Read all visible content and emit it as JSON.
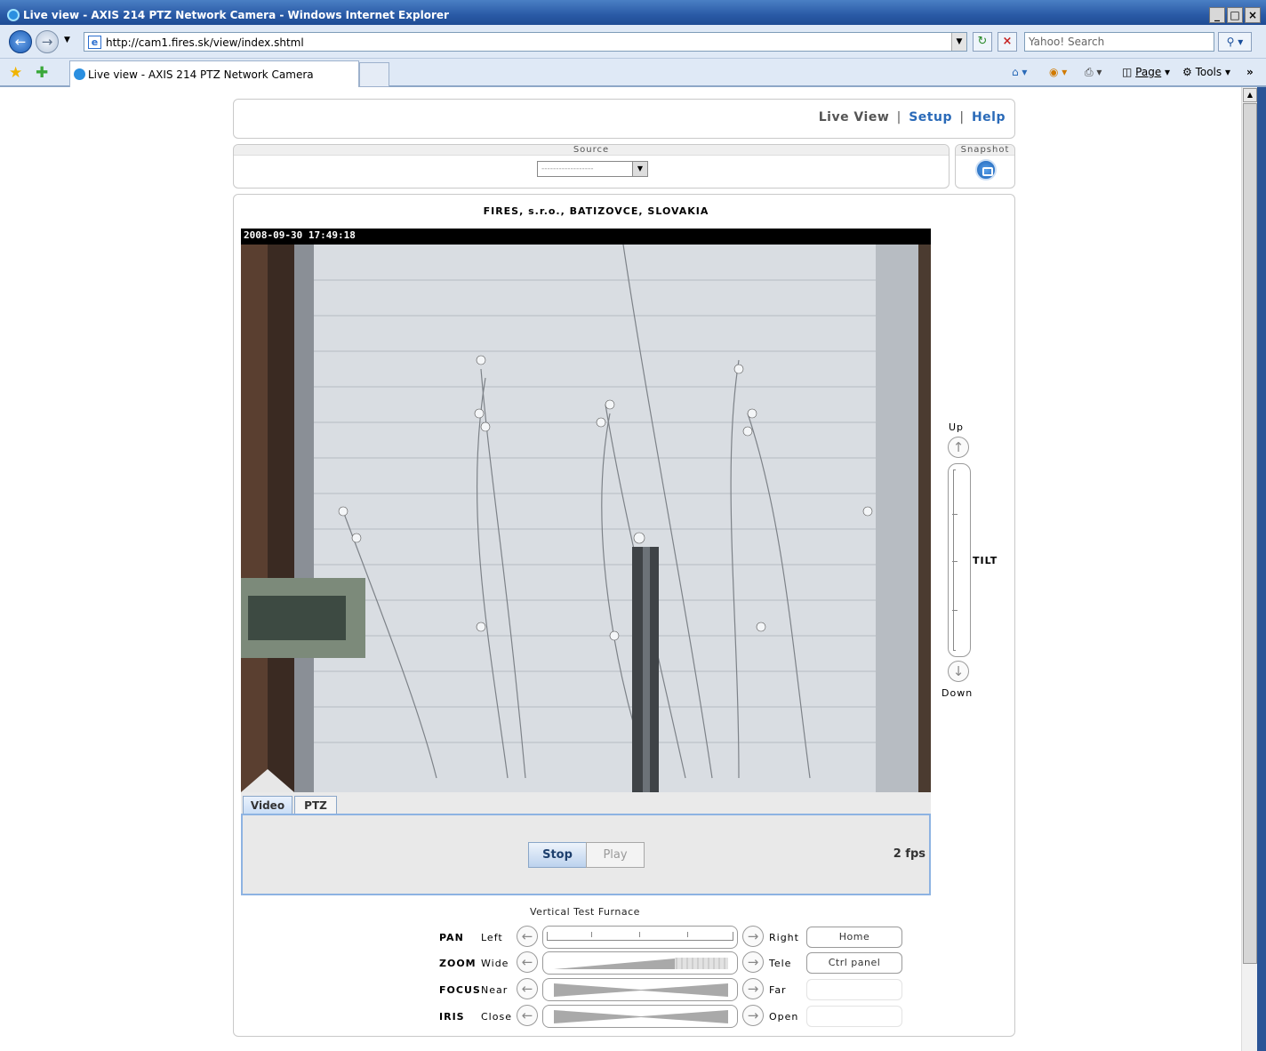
{
  "browser": {
    "window_title": "Live view - AXIS 214 PTZ Network Camera - Windows Internet Explorer",
    "url": "http://cam1.fires.sk/view/index.shtml",
    "search_placeholder": "Yahoo! Search",
    "tab_title": "Live view - AXIS 214 PTZ Network Camera",
    "page_menu": "Page",
    "tools_menu": "Tools",
    "win_min": "_",
    "win_max": "□",
    "win_close": "×",
    "chevron": "»"
  },
  "header": {
    "live_view": "Live View",
    "setup": "Setup",
    "help": "Help",
    "sep": "|"
  },
  "source": {
    "label": "Source",
    "value": "------------------"
  },
  "snapshot": {
    "label": "Snapshot"
  },
  "camera": {
    "title": "FIRES, s.r.o., BATIZOVCE, SLOVAKIA",
    "timestamp": "2008-09-30 17:49:18"
  },
  "tabs": {
    "video": "Video",
    "ptz": "PTZ"
  },
  "video_controls": {
    "stop": "Stop",
    "play": "Play",
    "fps": "2 fps"
  },
  "tilt": {
    "up": "Up",
    "down": "Down",
    "label": "TILT"
  },
  "ptz": {
    "preset_title": "Vertical Test Furnace",
    "rows": [
      {
        "name": "PAN",
        "left": "Left",
        "right": "Right",
        "button": "Home"
      },
      {
        "name": "ZOOM",
        "left": "Wide",
        "right": "Tele",
        "button": "Ctrl panel"
      },
      {
        "name": "FOCUS",
        "left": "Near",
        "right": "Far",
        "button": ""
      },
      {
        "name": "IRIS",
        "left": "Close",
        "right": "Open",
        "button": ""
      }
    ]
  }
}
